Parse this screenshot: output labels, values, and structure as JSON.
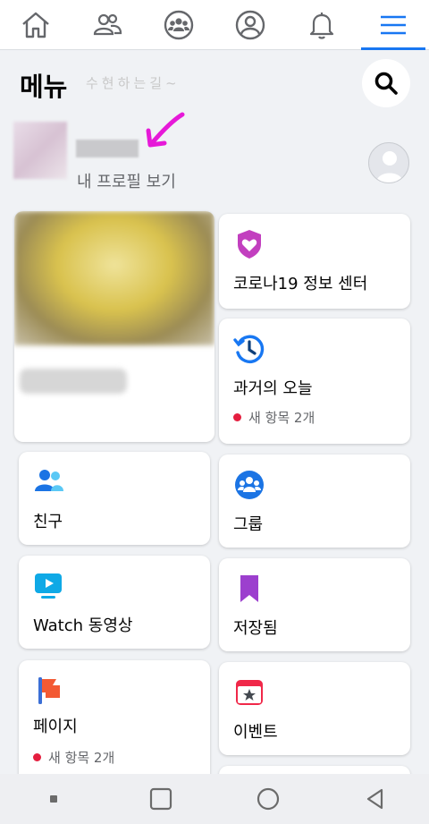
{
  "nav": {
    "tabs": [
      {
        "name": "home",
        "icon": "home-icon"
      },
      {
        "name": "friends",
        "icon": "friends-icon"
      },
      {
        "name": "groups",
        "icon": "groups-icon"
      },
      {
        "name": "profile",
        "icon": "profile-icon"
      },
      {
        "name": "notifications",
        "icon": "bell-icon"
      },
      {
        "name": "menu",
        "icon": "hamburger-icon",
        "active": true
      }
    ],
    "accent": "#1877f2"
  },
  "header": {
    "title": "메뉴",
    "watermark": "수현하는길~",
    "search_icon": "search-icon"
  },
  "profile": {
    "view_profile": "내 프로필 보기"
  },
  "shortcuts": {
    "covid": {
      "label": "코로나19 정보 센터",
      "icon": "shield-heart-icon",
      "color": "#c23fbf"
    },
    "memories": {
      "label": "과거의 오늘",
      "icon": "clock-history-icon",
      "color": "#1877f2",
      "badge": "새 항목 2개"
    },
    "friends": {
      "label": "친구",
      "icon": "friends-icon",
      "color": "#1b74e4"
    },
    "groups": {
      "label": "그룹",
      "icon": "groups-icon",
      "color": "#1b74e4"
    },
    "watch": {
      "label": "Watch 동영상",
      "icon": "video-icon",
      "color": "#0fa9e6"
    },
    "saved": {
      "label": "저장됨",
      "icon": "bookmark-icon",
      "color": "#9c3fce"
    },
    "pages": {
      "label": "페이지",
      "icon": "flag-icon",
      "color": "#f35a34",
      "badge": "새 항목 2개"
    },
    "events": {
      "label": "이벤트",
      "icon": "calendar-star-icon",
      "color": "#f02849"
    }
  },
  "badge_color": "#e41e3f",
  "sysbar": {
    "buttons": [
      "recent-dot-icon",
      "square-icon",
      "circle-icon",
      "back-triangle-icon"
    ]
  }
}
